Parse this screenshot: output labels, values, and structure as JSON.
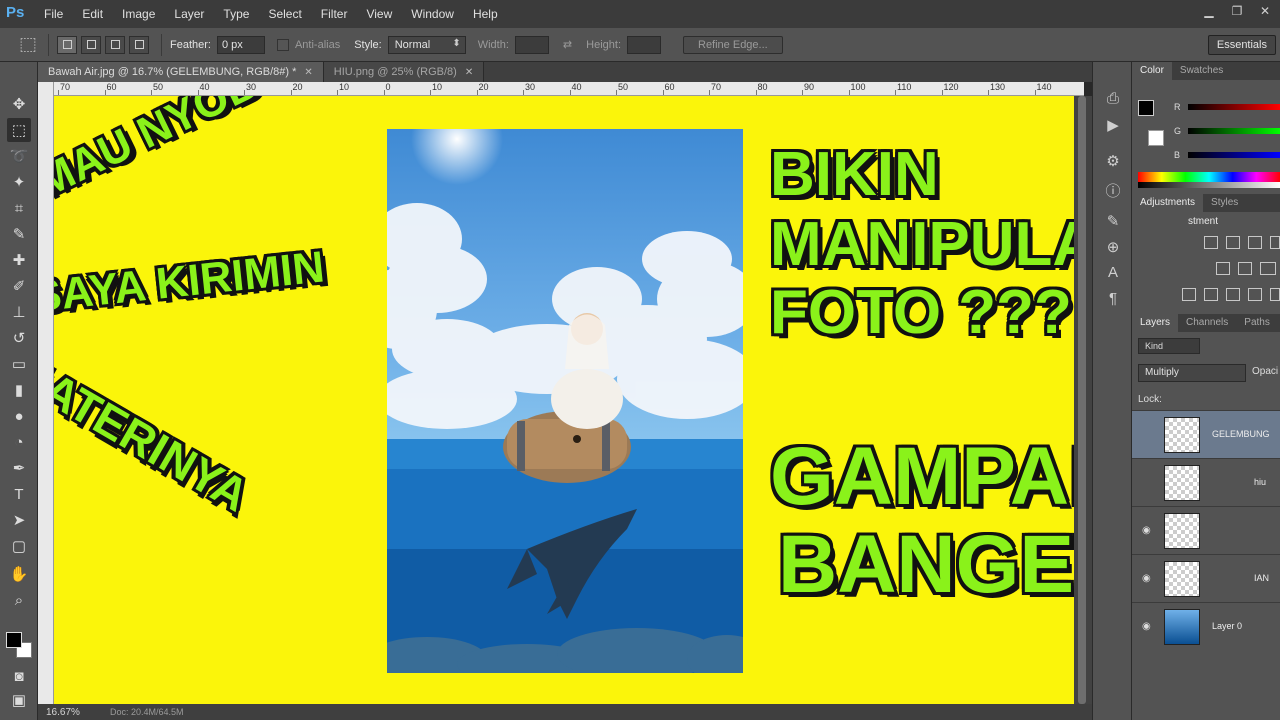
{
  "app": {
    "logo": "Ps"
  },
  "menu": [
    "File",
    "Edit",
    "Image",
    "Layer",
    "Type",
    "Select",
    "Filter",
    "View",
    "Window",
    "Help"
  ],
  "options": {
    "feather_label": "Feather:",
    "feather_value": "0 px",
    "antialias_label": "Anti-alias",
    "style_label": "Style:",
    "style_value": "Normal",
    "width_label": "Width:",
    "height_label": "Height:",
    "refine_label": "Refine Edge...",
    "workspace": "Essentials"
  },
  "tabs": [
    {
      "label": "Bawah Air.jpg @ 16.7% (GELEMBUNG, RGB/8#) *",
      "active": true
    },
    {
      "label": "HIU.png @ 25% (RGB/8)",
      "active": false
    }
  ],
  "ruler": [
    "70",
    "60",
    "50",
    "40",
    "30",
    "20",
    "10",
    "0",
    "10",
    "20",
    "30",
    "40",
    "50",
    "60",
    "70",
    "80",
    "90",
    "100",
    "110",
    "120",
    "130",
    "140"
  ],
  "status": {
    "zoom": "16.67%",
    "doc": "Doc: 20.4M/64.5M"
  },
  "panels": {
    "color_tabs": [
      "Color",
      "Swatches"
    ],
    "rgb": [
      "R",
      "G",
      "B"
    ],
    "adjust_tabs": [
      "Adjustments",
      "Styles"
    ],
    "adjust_title": "stment",
    "layers_tabs": [
      "Layers",
      "Channels",
      "Paths"
    ],
    "kind": "Kind",
    "blend_mode": "Multiply",
    "opacity_label": "Opaci",
    "lock_label": "Lock:",
    "layers": [
      {
        "name": "GELEMBUNG",
        "selected": true
      },
      {
        "name": "hiu",
        "selected": false
      },
      {
        "name": "",
        "selected": false
      },
      {
        "name": "IAN",
        "selected": false
      },
      {
        "name": "Layer 0",
        "selected": false
      }
    ]
  },
  "overlay": {
    "left": [
      "MAU NYOBA?",
      "SAYA KIRIMIN",
      "MATERINYA"
    ],
    "right_top": [
      "BIKIN",
      "MANIPULASI",
      "FOTO ???"
    ],
    "right_bottom": [
      "GAMPANG",
      "BANGET !!!"
    ]
  },
  "colors": {
    "canvas": "#fbf50a",
    "headline": "#8af21a",
    "outline": "#111111"
  }
}
